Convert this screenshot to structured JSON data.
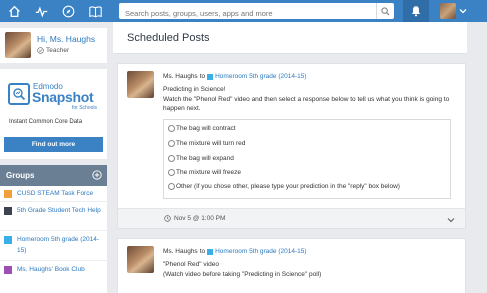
{
  "topbar": {
    "search_placeholder": "Search posts, groups, users, apps and more",
    "nav_icons": [
      "home-icon",
      "activity-icon",
      "discover-icon",
      "library-icon"
    ]
  },
  "profile": {
    "greeting": "Hi, Ms. Haughs",
    "role": "Teacher"
  },
  "ad": {
    "edmodo": "Edmodo",
    "snapshot": "Snapshot",
    "for_schools": "for Schools",
    "tagline": "Instant Common Core Data",
    "button": "Find out more"
  },
  "groups": {
    "title": "Groups",
    "items": [
      {
        "label": "CUSD STEAM Task Force",
        "color": "#f0a13a"
      },
      {
        "label": "5th Grade Student Tech Help",
        "color": "#3c4452"
      },
      {
        "label": "Homeroom 5th grade (2014-15)",
        "color": "#3bb0e6"
      },
      {
        "label": "Ms. Haughs' Book Club",
        "color": "#9b4fb3"
      }
    ]
  },
  "main": {
    "title": "Scheduled Posts"
  },
  "posts": [
    {
      "author": "Ms. Haughs",
      "to": "to",
      "group": "Homeroom 5th grade (2014-15)",
      "line1": "Predicting in Science!",
      "line2": "Watch the \"Phenol Red\" video and then select a response below to tell us what you think is going to happen next.",
      "options": [
        "The bag will contract",
        "The mixture will turn red",
        "The bag will expand",
        "The mixture will freeze",
        "Other (if you chose other, please type your prediction in the \"reply\" box below)"
      ],
      "date": "Nov 5 @ 1:00 PM"
    },
    {
      "author": "Ms. Haughs",
      "to": "to",
      "group": "Homeroom 5th grade (2014-15)",
      "line1": "\"Phenol Red\" video",
      "line2": "(Watch video before taking \"Predicting in Science\" poll)"
    }
  ]
}
